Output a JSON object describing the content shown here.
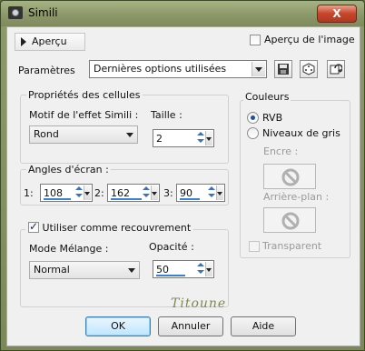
{
  "window": {
    "title": "Simili",
    "close_label": "X",
    "title_color": "#8c986a"
  },
  "preview": {
    "button_label": "Aperçu",
    "checkbox_label": "Aperçu de l'image",
    "checkbox_checked": false
  },
  "params": {
    "label": "Paramètres",
    "value": "Dernières options utilisées",
    "icons": [
      "save-icon",
      "dice-icon",
      "reset-icon"
    ]
  },
  "cells": {
    "title": "Propriétés des cellules",
    "motif_label": "Motif de l'effet Simili :",
    "motif_value": "Rond",
    "size_label": "Taille :",
    "size_value": "2"
  },
  "angles": {
    "title": "Angles d'écran :",
    "items": [
      {
        "label": "1:",
        "value": "108"
      },
      {
        "label": "2:",
        "value": "162"
      },
      {
        "label": "3:",
        "value": "90"
      }
    ]
  },
  "overlay": {
    "checkbox_label": "Utiliser comme recouvrement",
    "checked": true,
    "mode_label": "Mode Mélange :",
    "mode_value": "Normal",
    "opacity_label": "Opacité :",
    "opacity_value": "50"
  },
  "colors": {
    "title": "Couleurs",
    "rgb_label": "RVB",
    "rgb_selected": true,
    "gray_label": "Niveaux de gris",
    "gray_selected": false,
    "ink_label": "Encre :",
    "background_label": "Arrière-plan :",
    "transparent_label": "Transparent",
    "transparent_checked": false
  },
  "watermark": "Titoune",
  "buttons": {
    "ok": "OK",
    "cancel": "Annuler",
    "help": "Aide"
  },
  "accent": "#3c7fd6"
}
